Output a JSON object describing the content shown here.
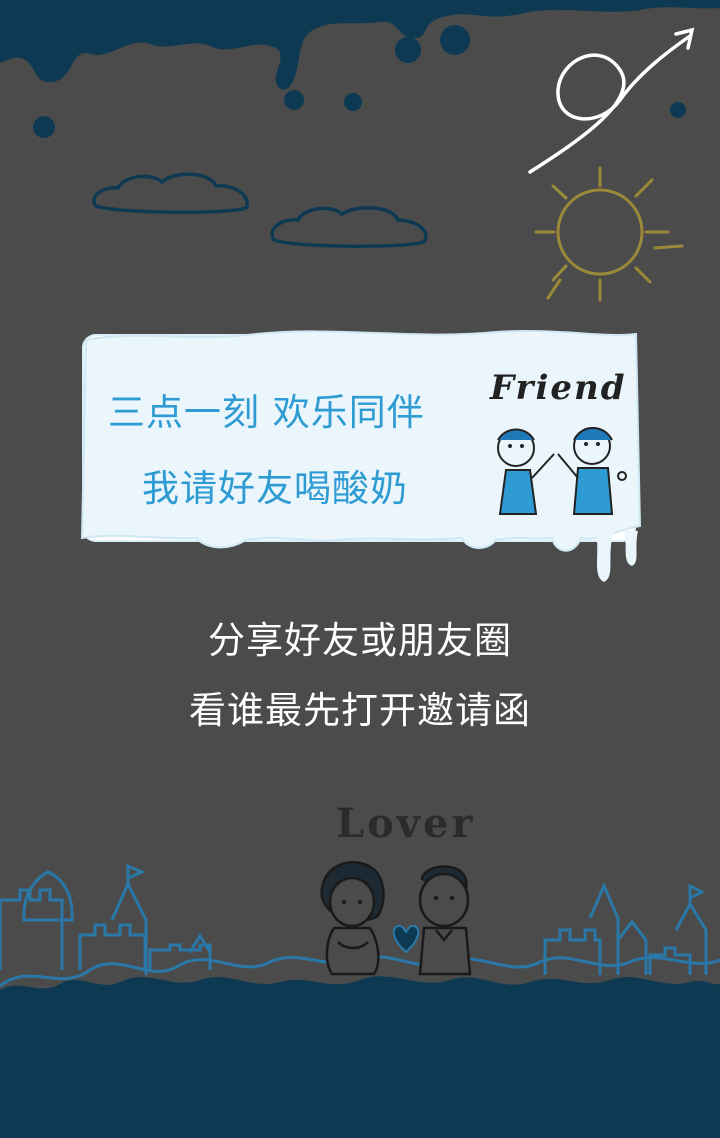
{
  "card": {
    "line1": "三点一刻  欢乐同伴",
    "line2": "我请好友喝酸奶",
    "sticker_word": "Friend"
  },
  "share": {
    "line1": "分享好友或朋友圈",
    "line2": "看谁最先打开邀请函"
  },
  "lover_word": "Lover",
  "colors": {
    "background": "#4b4b4b",
    "accent_blue": "#2f9bd3",
    "ink_dark_blue": "#0d3a52",
    "sun": "#9a8a3a"
  },
  "icons": [
    "arrow-loop-icon",
    "sun-icon",
    "cloud-icon",
    "castle-icon",
    "heart-icon"
  ]
}
